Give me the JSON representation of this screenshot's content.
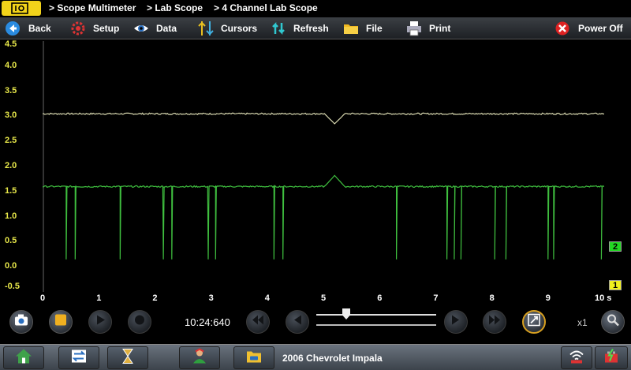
{
  "titlebar": {
    "breadcrumbs": [
      "> Scope Multimeter",
      "> Lab Scope",
      "> 4 Channel Lab Scope"
    ]
  },
  "toolbar": {
    "back": "Back",
    "setup": "Setup",
    "data": "Data",
    "cursors": "Cursors",
    "refresh": "Refresh",
    "file": "File",
    "print": "Print",
    "power_off": "Power Off"
  },
  "plot": {
    "y_ticks": [
      "4.5",
      "4.0",
      "3.5",
      "3.0",
      "2.5",
      "2.0",
      "1.5",
      "1.0",
      "0.5",
      "0.0",
      "-0.5"
    ],
    "x_ticks": [
      "0",
      "1",
      "2",
      "3",
      "4",
      "5",
      "6",
      "7",
      "8",
      "9",
      "10 s"
    ],
    "channel_markers": [
      {
        "label": "2",
        "color": "#22d822"
      },
      {
        "label": "1",
        "color": "#f2f21e"
      }
    ]
  },
  "chart_data": {
    "type": "line",
    "xlim": [
      0,
      10
    ],
    "ylim": [
      -0.5,
      4.5
    ],
    "series": [
      {
        "color": "#d8d8b0",
        "baseline": 3.05,
        "events": [
          {
            "x": 5.2,
            "y": 2.85
          }
        ]
      },
      {
        "color": "#3fbf3f",
        "baseline": 1.6,
        "spikes": [
          0.42,
          0.58,
          1.38,
          2.15,
          2.3,
          2.95,
          3.08,
          4.12,
          4.28,
          6.3,
          7.2,
          7.33,
          7.45,
          8.05,
          8.25,
          9.0,
          9.1,
          9.95
        ],
        "spike_min": 0.15,
        "events": [
          {
            "x": 5.2,
            "y": 1.82
          }
        ]
      }
    ]
  },
  "transport": {
    "time": "10:24:640",
    "zoom": "x1",
    "slider_position": 0.25
  },
  "taskbar": {
    "vehicle": "2006 Chevrolet Impala"
  }
}
